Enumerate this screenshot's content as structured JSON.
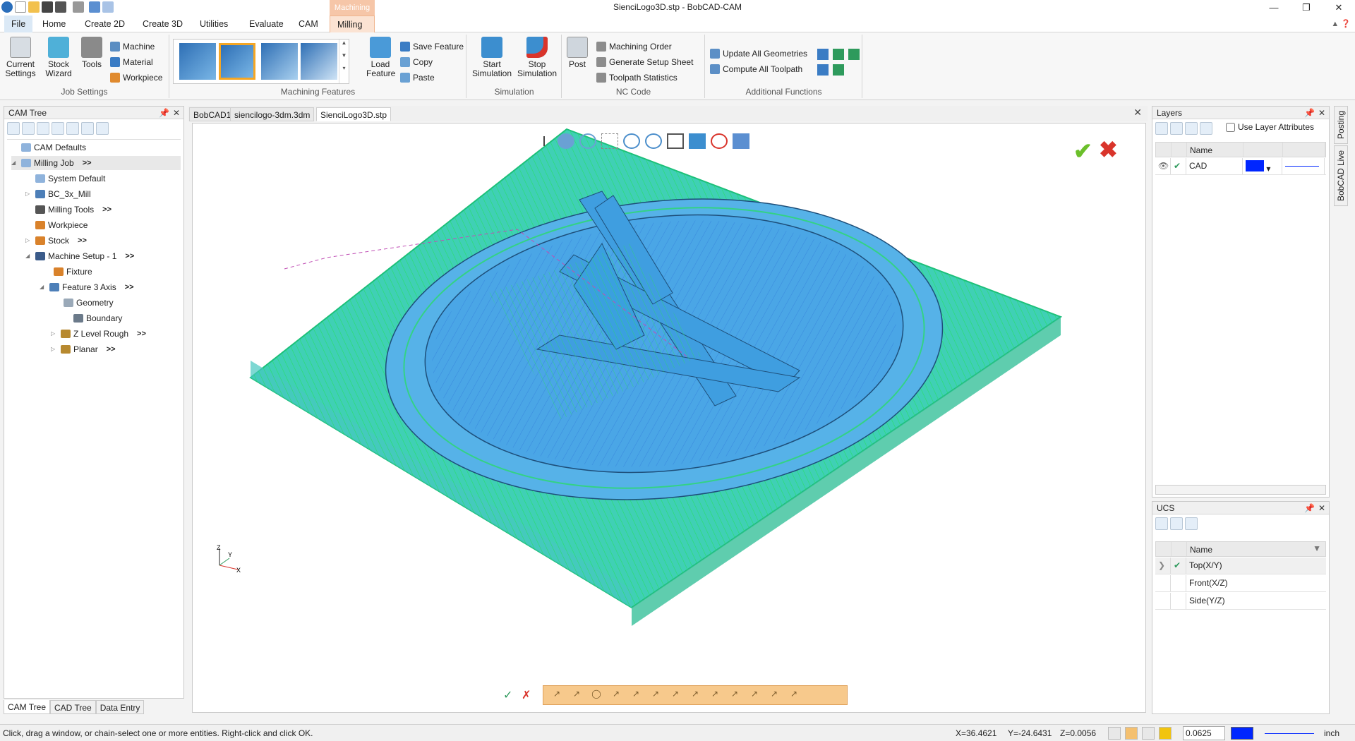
{
  "window": {
    "title": "SienciLogo3D.stp - BobCAD-CAM",
    "context_tab_title": "Machining",
    "controls": [
      "—",
      "❐",
      "✕"
    ]
  },
  "ribbon_tabs": [
    "File",
    "Home",
    "Create 2D",
    "Create 3D",
    "Utilities",
    "Evaluate",
    "CAM",
    "Milling"
  ],
  "ribbon": {
    "job_settings": {
      "label": "Job Settings",
      "current_settings": "Current Settings",
      "stock_wizard": "Stock Wizard",
      "tools": "Tools",
      "machine": "Machine",
      "material": "Material",
      "workpiece": "Workpiece"
    },
    "machining_features": {
      "label": "Machining Features",
      "load_feature": "Load Feature",
      "save_feature": "Save Feature",
      "copy": "Copy",
      "paste": "Paste"
    },
    "simulation": {
      "label": "Simulation",
      "start": "Start Simulation",
      "stop": "Stop Simulation"
    },
    "nc_code": {
      "label": "NC Code",
      "post": "Post",
      "machining_order": "Machining Order",
      "generate_setup_sheet": "Generate Setup Sheet",
      "toolpath_statistics": "Toolpath Statistics"
    },
    "additional": {
      "label": "Additional Functions",
      "update_all": "Update All Geometries",
      "compute_all": "Compute All Toolpath"
    }
  },
  "cam_tree": {
    "title": "CAM Tree",
    "items": [
      {
        "label": "CAM Defaults",
        "more": ""
      },
      {
        "label": "Milling Job",
        "more": ">>"
      },
      {
        "label": "System Default",
        "more": ""
      },
      {
        "label": "BC_3x_Mill",
        "more": ""
      },
      {
        "label": "Milling Tools",
        "more": ">>"
      },
      {
        "label": "Workpiece",
        "more": ""
      },
      {
        "label": "Stock",
        "more": ">>"
      },
      {
        "label": "Machine Setup - 1",
        "more": ">>"
      },
      {
        "label": "Fixture",
        "more": ""
      },
      {
        "label": "Feature 3 Axis",
        "more": ">>"
      },
      {
        "label": "Geometry",
        "more": ""
      },
      {
        "label": "Boundary",
        "more": ""
      },
      {
        "label": "Z Level Rough",
        "more": ">>"
      },
      {
        "label": "Planar",
        "more": ">>"
      }
    ],
    "bottom_tabs": [
      "CAM Tree",
      "CAD Tree",
      "Data Entry"
    ]
  },
  "doc_tabs": [
    "BobCAD1",
    "siencilogo-3dm.3dm",
    "SienciLogo3D.stp"
  ],
  "layers": {
    "title": "Layers",
    "use_layer_attributes": "Use Layer Attributes",
    "col_name": "Name",
    "rows": [
      {
        "name": "CAD",
        "color": "#0026ff"
      }
    ]
  },
  "ucs": {
    "title": "UCS",
    "col_name": "Name",
    "rows": [
      "Top(X/Y)",
      "Front(X/Z)",
      "Side(Y/Z)"
    ]
  },
  "side_tabs": [
    "Posting",
    "BobCAD Live"
  ],
  "statusbar": {
    "message": "Click, drag a window, or chain-select one or more entities. Right-click and click OK.",
    "x": "X=36.4621",
    "y": "Y=-24.6431",
    "z": "Z=0.0056",
    "increment": "0.0625",
    "unit": "inch"
  },
  "colors": {
    "toolpath": "#22e86a",
    "part": "#49b5e8",
    "accent": "#f5a623"
  }
}
